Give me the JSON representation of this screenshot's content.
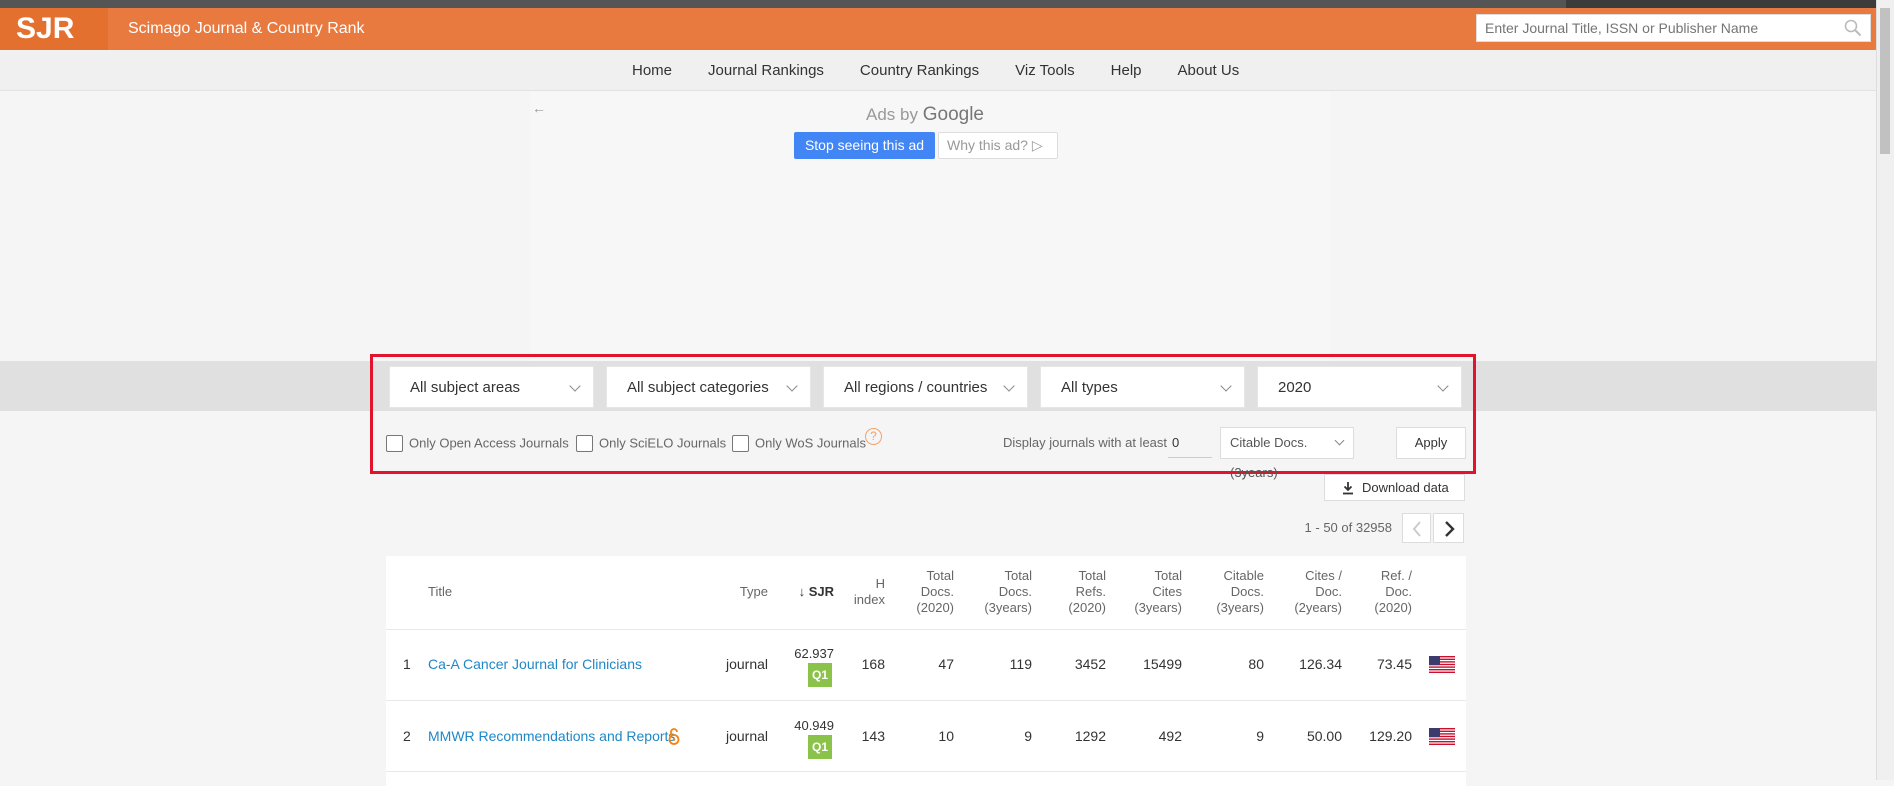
{
  "header": {
    "logo": "SJR",
    "site_title": "Scimago Journal & Country Rank",
    "search_placeholder": "Enter Journal Title, ISSN or Publisher Name"
  },
  "nav": {
    "items": [
      "Home",
      "Journal Rankings",
      "Country Rankings",
      "Viz Tools",
      "Help",
      "About Us"
    ],
    "active": "Journal Rankings"
  },
  "ad": {
    "back_arrow": "←",
    "ads_by": "Ads by",
    "google": "Google",
    "stop_label": "Stop seeing this ad",
    "why_label": "Why this ad?",
    "why_icon": "▷"
  },
  "filters": {
    "subject_area": "All subject areas",
    "subject_category": "All subject categories",
    "region": "All regions / countries",
    "type": "All types",
    "year": "2020",
    "open_access_label": "Only Open Access Journals",
    "scielo_label": "Only SciELO Journals",
    "wos_label": "Only WoS Journals",
    "help_mark": "?",
    "min_label": "Display journals with at least",
    "min_value": "0",
    "citable_select": "Citable Docs. (3years)",
    "apply_label": "Apply"
  },
  "download_label": "Download data",
  "pager": {
    "text": "1 - 50 of 32958"
  },
  "table": {
    "headers": {
      "title": "Title",
      "type": "Type",
      "sjr": "SJR",
      "h_index": [
        "H",
        "index"
      ],
      "total_docs_2020": [
        "Total",
        "Docs.",
        "(2020)"
      ],
      "total_docs_3y": [
        "Total",
        "Docs.",
        "(3years)"
      ],
      "total_refs_2020": [
        "Total",
        "Refs.",
        "(2020)"
      ],
      "total_cites_3y": [
        "Total",
        "Cites",
        "(3years)"
      ],
      "citable_docs_3y": [
        "Citable",
        "Docs.",
        "(3years)"
      ],
      "cites_per_doc_2y": [
        "Cites /",
        "Doc.",
        "(2years)"
      ],
      "ref_per_doc_2020": [
        "Ref. /",
        "Doc.",
        "(2020)"
      ]
    },
    "rows": [
      {
        "rank": "1",
        "title": "Ca-A Cancer Journal for Clinicians",
        "type": "journal",
        "sjr": "62.937",
        "quartile": "Q1",
        "h_index": "168",
        "total_docs_2020": "47",
        "total_docs_3y": "119",
        "total_refs_2020": "3452",
        "total_cites_3y": "15499",
        "citable_docs_3y": "80",
        "cites_per_doc_2y": "126.34",
        "ref_per_doc_2020": "73.45",
        "country_icon": "us-flag-icon"
      },
      {
        "rank": "2",
        "title": "MMWR Recommendations and Reports",
        "type": "journal",
        "sjr": "40.949",
        "quartile": "Q1",
        "h_index": "143",
        "total_docs_2020": "10",
        "total_docs_3y": "9",
        "total_refs_2020": "1292",
        "total_cites_3y": "492",
        "citable_docs_3y": "9",
        "cites_per_doc_2y": "50.00",
        "ref_per_doc_2020": "129.20",
        "country_icon": "us-flag-icon",
        "open_access_icon": "open-access-icon"
      }
    ]
  },
  "colors": {
    "brand_orange": "#e87a3f",
    "link_blue": "#1e88c7",
    "q1_green": "#8bc34a",
    "highlight_red": "#e0142c",
    "ad_blue": "#4285f4"
  }
}
